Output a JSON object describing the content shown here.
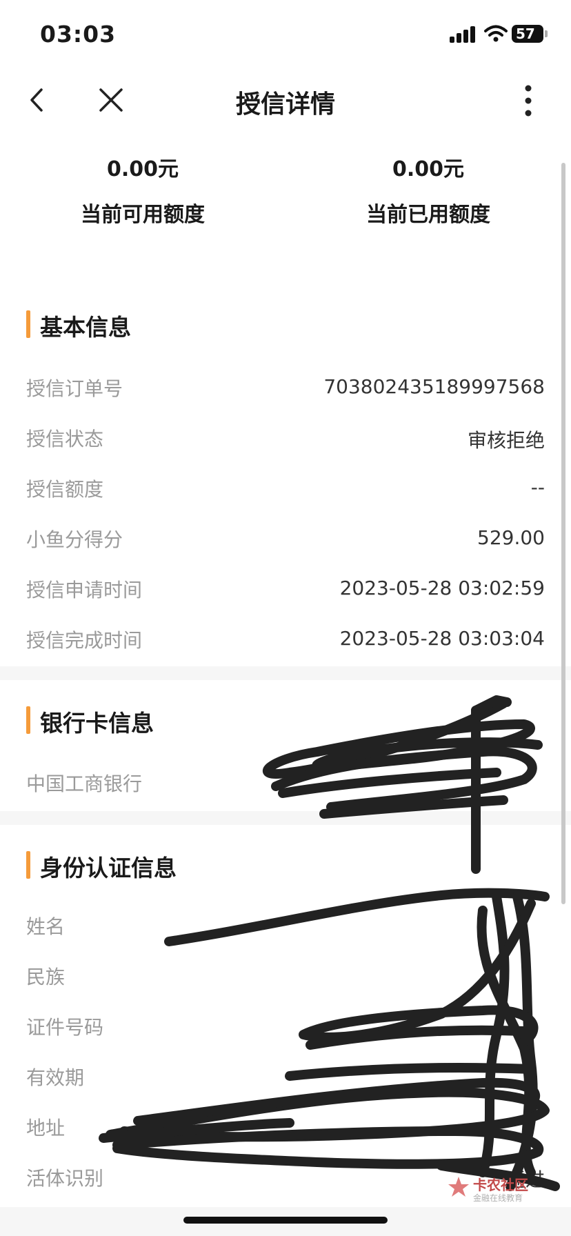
{
  "status_bar": {
    "time": "03:03",
    "battery": "57"
  },
  "nav": {
    "title": "授信详情"
  },
  "summary": {
    "available": {
      "value": "0.00元",
      "label": "当前可用额度"
    },
    "used": {
      "value": "0.00元",
      "label": "当前已用额度"
    }
  },
  "basic_info": {
    "title": "基本信息",
    "rows": [
      {
        "label": "授信订单号",
        "value": "703802435189997568"
      },
      {
        "label": "授信状态",
        "value": "审核拒绝"
      },
      {
        "label": "授信额度",
        "value": "--"
      },
      {
        "label": "小鱼分得分",
        "value": "529.00"
      },
      {
        "label": "授信申请时间",
        "value": "2023-05-28 03:02:59"
      },
      {
        "label": "授信完成时间",
        "value": "2023-05-28 03:03:04"
      }
    ]
  },
  "bank_info": {
    "title": "银行卡信息",
    "rows": [
      {
        "label": "中国工商银行"
      }
    ]
  },
  "identity_info": {
    "title": "身份认证信息",
    "rows": [
      {
        "label": "姓名"
      },
      {
        "label": "民族"
      },
      {
        "label": "证件号码"
      },
      {
        "label": "有效期"
      },
      {
        "label": "地址"
      },
      {
        "label": "活体识别",
        "value": "通过"
      }
    ]
  },
  "watermark": {
    "brand": "卡农社区",
    "slogan": "金融在线教育"
  },
  "colors": {
    "accent": "#f59b3a",
    "label_gray": "#9a9a9a",
    "scribble": "#222222"
  }
}
